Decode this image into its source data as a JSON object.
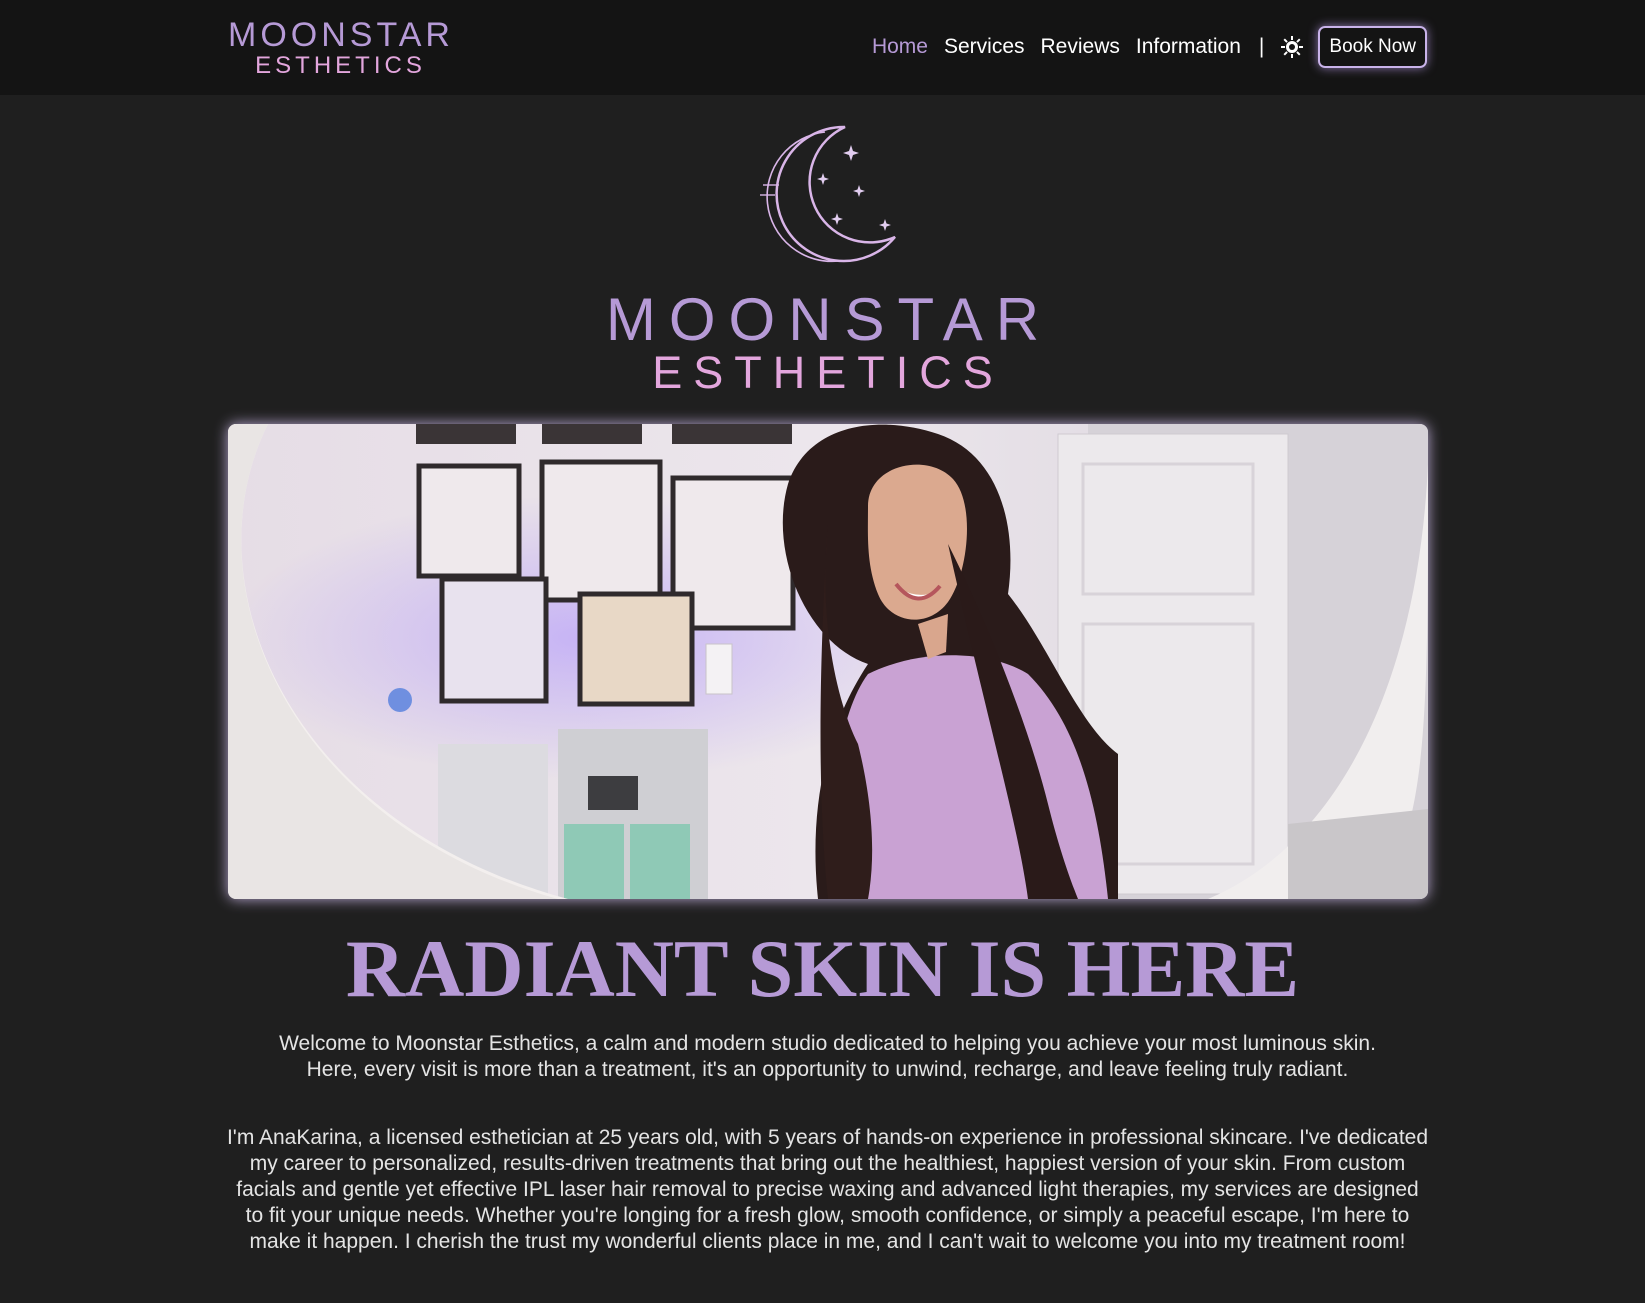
{
  "header": {
    "brand_line1": "MOONSTAR",
    "brand_line2": "ESTHETICS",
    "nav": [
      "Home",
      "Services",
      "Reviews",
      "Information"
    ],
    "active_nav": "Home",
    "separator": "|",
    "theme_icon": "sun-icon",
    "book_label": "Book Now"
  },
  "logo": {
    "icon": "crescent-moon-stars-icon",
    "line1": "MOONSTAR",
    "line2": "ESTHETICS"
  },
  "hero": {
    "headline": "RADIANT SKIN IS HERE",
    "intro": "Welcome to Moonstar Esthetics, a calm and modern studio dedicated to helping you achieve your most luminous skin. Here, every visit is more than a treatment, it's an opportunity to unwind, recharge, and leave feeling truly radiant.",
    "about": "I'm AnaKarina, a licensed esthetician at 25 years old, with 5 years of hands-on experience in professional skincare. I've dedicated my career to personalized, results-driven treatments that bring out the healthiest, happiest version of your skin. From custom facials and gentle yet effective IPL laser hair removal to precise waxing and advanced light therapies, my services are designed to fit your unique needs. Whether you're longing for a fresh glow, smooth confidence, or simply a peaceful escape, I'm here to make it happen. I cherish the trust my wonderful clients place in me, and I can't wait to welcome you into my treatment room!"
  },
  "colors": {
    "background": "#1f1f1f",
    "header_bg": "#141414",
    "lavender": "#b69ad6",
    "pink": "#e3a6dd"
  }
}
